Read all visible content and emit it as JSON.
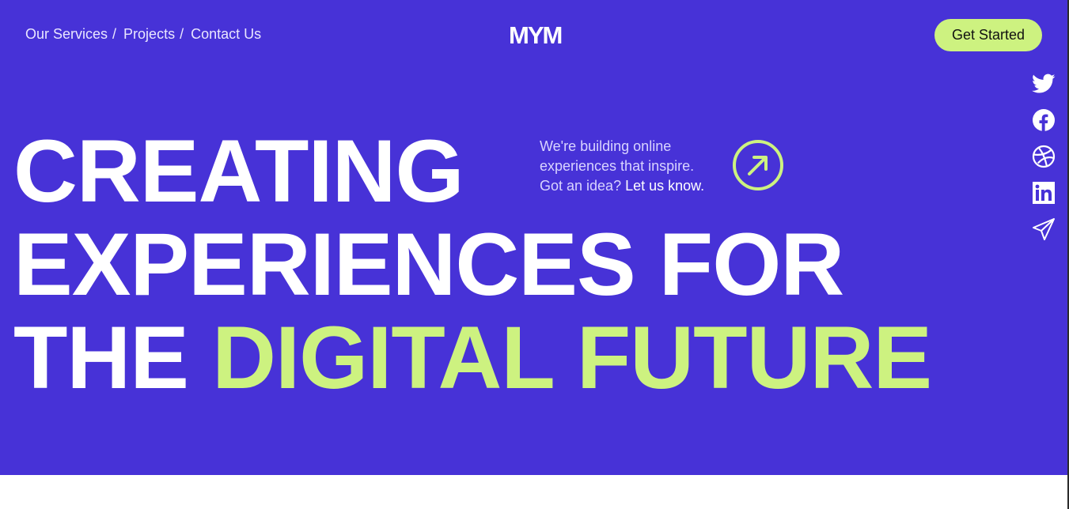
{
  "nav": {
    "items": [
      {
        "label": "Our Services",
        "sep": "/"
      },
      {
        "label": "Projects",
        "sep": "/"
      },
      {
        "label": "Contact Us",
        "sep": ""
      }
    ]
  },
  "logo": {
    "text": "MYM"
  },
  "cta": {
    "label": "Get Started"
  },
  "socials": [
    "twitter-icon",
    "facebook-icon",
    "dribbble-icon",
    "linkedin-icon",
    "send-icon"
  ],
  "hero": {
    "line1": "CREATING",
    "line2": "EXPERIENCES FOR",
    "line3_white": "THE",
    "line3_accent": "DIGITAL FUTURE",
    "tagline": {
      "line1": "We're building online",
      "line2": "experiences that inspire.",
      "line3": "Got an idea?",
      "link": "Let us know."
    }
  },
  "colors": {
    "background": "#4732d7",
    "accent": "#cdf280",
    "text": "#ffffff"
  }
}
